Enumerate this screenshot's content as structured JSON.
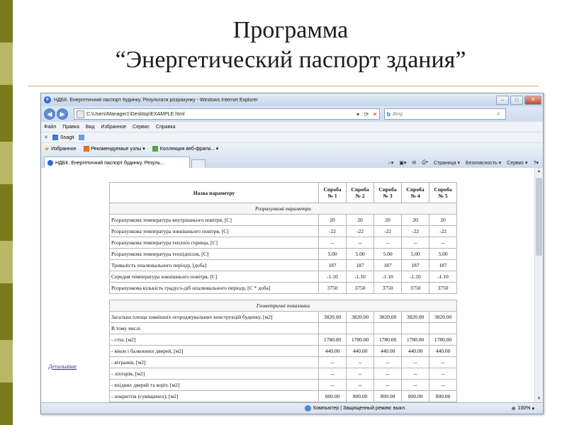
{
  "slide": {
    "title_line1": "Программа",
    "title_line2": "“Энергетический паспорт здания”"
  },
  "browser": {
    "window_title": "НДБК. Енергетичний паспорт будинку. Результати розрахунку - Windows Internet Explorer",
    "address": "C:\\Users\\Manager1\\Desktop\\EXAMPLE.html",
    "search_placeholder": "Bing",
    "menu": [
      "Файл",
      "Правка",
      "Вид",
      "Избранное",
      "Сервис",
      "Справка"
    ],
    "snagit_label": "Snagit",
    "favorites_label": "Избранное",
    "fav_items": [
      "Рекомендуемые узлы ▾",
      "Коллекция веб-фрагм... ▾"
    ],
    "tab_label": "НДБК. Енергетичний паспорт будинку. Резуль...",
    "commands": [
      "Страница ▾",
      "Безопасность ▾",
      "Сервис ▾"
    ],
    "status_zone": "Компьютер | Защищенный режим: выкл.",
    "zoom": "100%"
  },
  "content": {
    "detail_link": "Детальніше",
    "header": [
      "Назва параметру",
      "Спроба № 1",
      "Спроба № 2",
      "Спроба № 3",
      "Спроба № 4",
      "Спроба № 5"
    ],
    "section1": "Розрахункові параметри",
    "rows1": [
      {
        "name": "Розрахункова температура внутрішнього повітря, [C]",
        "values": [
          "20",
          "20",
          "20",
          "20",
          "20"
        ]
      },
      {
        "name": "Розрахункова температура зовнішнього повітря, [C]",
        "values": [
          "-22",
          "-22",
          "-22",
          "-22",
          "-22"
        ]
      },
      {
        "name": "Розрахункова температура теплого горища, [C]",
        "values": [
          "--",
          "--",
          "--",
          "--",
          "--"
        ]
      },
      {
        "name": "Розрахункова температура техпідпілля, [C]",
        "values": [
          "5.00",
          "5.00",
          "5.00",
          "5.00",
          "5.00"
        ]
      },
      {
        "name": "Тривалість опалювального періоду, [доба]",
        "values": [
          "187",
          "187",
          "187",
          "187",
          "187"
        ]
      },
      {
        "name": "Середня температура зовнішнього повітря, [C]",
        "values": [
          "-1.10",
          "-1.10",
          "-1.10",
          "-1.10",
          "-1.10"
        ]
      },
      {
        "name": "Розрахункова кількість градусо-діб опалювального періоду, [C * доба]",
        "values": [
          "3750",
          "3750",
          "3750",
          "3750",
          "3750"
        ]
      }
    ],
    "section2": "Геометричні показники",
    "rows2": [
      {
        "name": "Загальна площа зовнішніх огороджувальних конструкцій будинку, [м2]",
        "values": [
          "3820.00",
          "3820.00",
          "3820.00",
          "3820.00",
          "3820.00"
        ]
      },
      {
        "name": "В тому числі",
        "values": []
      },
      {
        "name": "- стін, [м2]",
        "values": [
          "1780.00",
          "1780.00",
          "1780.00",
          "1780.00",
          "1780.00"
        ]
      },
      {
        "name": "- вікон і балконних дверей, [м2]",
        "values": [
          "440.00",
          "440.00",
          "440.00",
          "440.00",
          "440.00"
        ]
      },
      {
        "name": "- вітражів, [м2]",
        "values": [
          "--",
          "--",
          "--",
          "--",
          "--"
        ]
      },
      {
        "name": "- ліхтарів, [м2]",
        "values": [
          "--",
          "--",
          "--",
          "--",
          "--"
        ]
      },
      {
        "name": "- вхідних дверей та воріт, [м2]",
        "values": [
          "--",
          "--",
          "--",
          "--",
          "--"
        ]
      },
      {
        "name": "- покриттів (суміщених), [м2]",
        "values": [
          "800.00",
          "800.00",
          "800.00",
          "800.00",
          "800.00"
        ]
      }
    ]
  }
}
